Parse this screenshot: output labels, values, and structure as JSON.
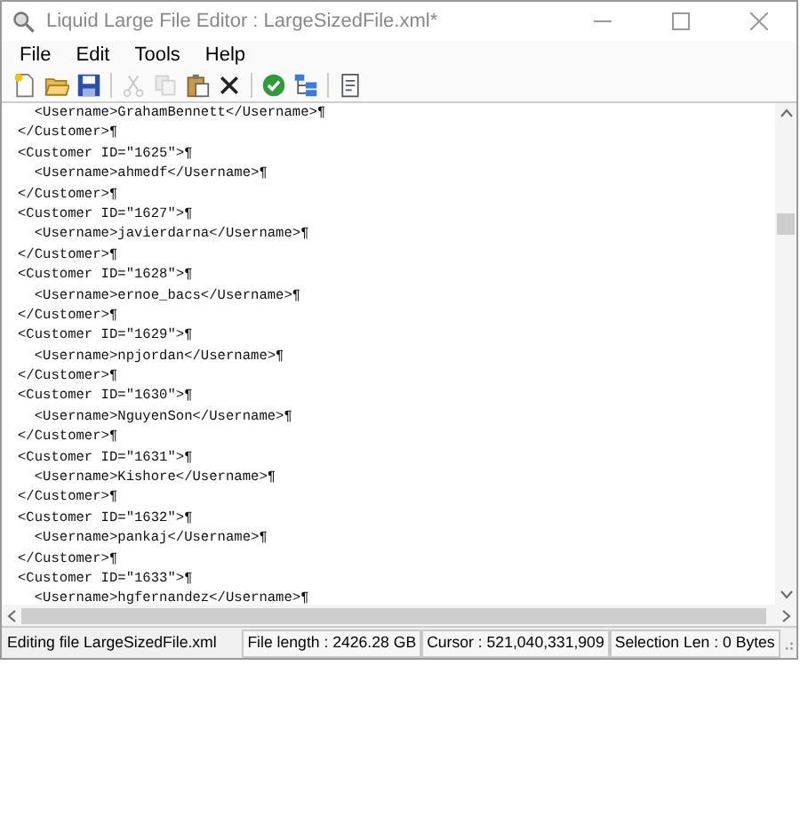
{
  "window": {
    "title": "Liquid Large File Editor : LargeSizedFile.xml*"
  },
  "menu": [
    "File",
    "Edit",
    "Tools",
    "Help"
  ],
  "toolbar": [
    {
      "kind": "new",
      "disabled": false
    },
    {
      "kind": "open",
      "disabled": false
    },
    {
      "kind": "save",
      "disabled": false
    },
    {
      "kind": "sep"
    },
    {
      "kind": "cut",
      "disabled": true
    },
    {
      "kind": "copy",
      "disabled": true
    },
    {
      "kind": "paste",
      "disabled": false
    },
    {
      "kind": "delete",
      "disabled": false
    },
    {
      "kind": "sep"
    },
    {
      "kind": "validate",
      "disabled": false
    },
    {
      "kind": "tree",
      "disabled": false
    },
    {
      "kind": "sep"
    },
    {
      "kind": "page",
      "disabled": false
    }
  ],
  "editor": {
    "lines": [
      "  <Username>GrahamBennett</Username>¶",
      "</Customer>¶",
      "<Customer ID=\"1625\">¶",
      "  <Username>ahmedf</Username>¶",
      "</Customer>¶",
      "<Customer ID=\"1627\">¶",
      "  <Username>javierdarna</Username>¶",
      "</Customer>¶",
      "<Customer ID=\"1628\">¶",
      "  <Username>ernoe_bacs</Username>¶",
      "</Customer>¶",
      "<Customer ID=\"1629\">¶",
      "  <Username>npjordan</Username>¶",
      "</Customer>¶",
      "<Customer ID=\"1630\">¶",
      "  <Username>NguyenSon</Username>¶",
      "</Customer>¶",
      "<Customer ID=\"1631\">¶",
      "  <Username>Kishore</Username>¶",
      "</Customer>¶",
      "<Customer ID=\"1632\">¶",
      "  <Username>pankaj</Username>¶",
      "</Customer>¶",
      "<Customer ID=\"1633\">¶",
      "  <Username>hgfernandez</Username>¶"
    ]
  },
  "status_bar": [
    "Editing file LargeSizedFile.xml",
    "File length : 2426.28 GB",
    "Cursor : 521,040,331,909",
    "Selection Len : 0 Bytes"
  ]
}
